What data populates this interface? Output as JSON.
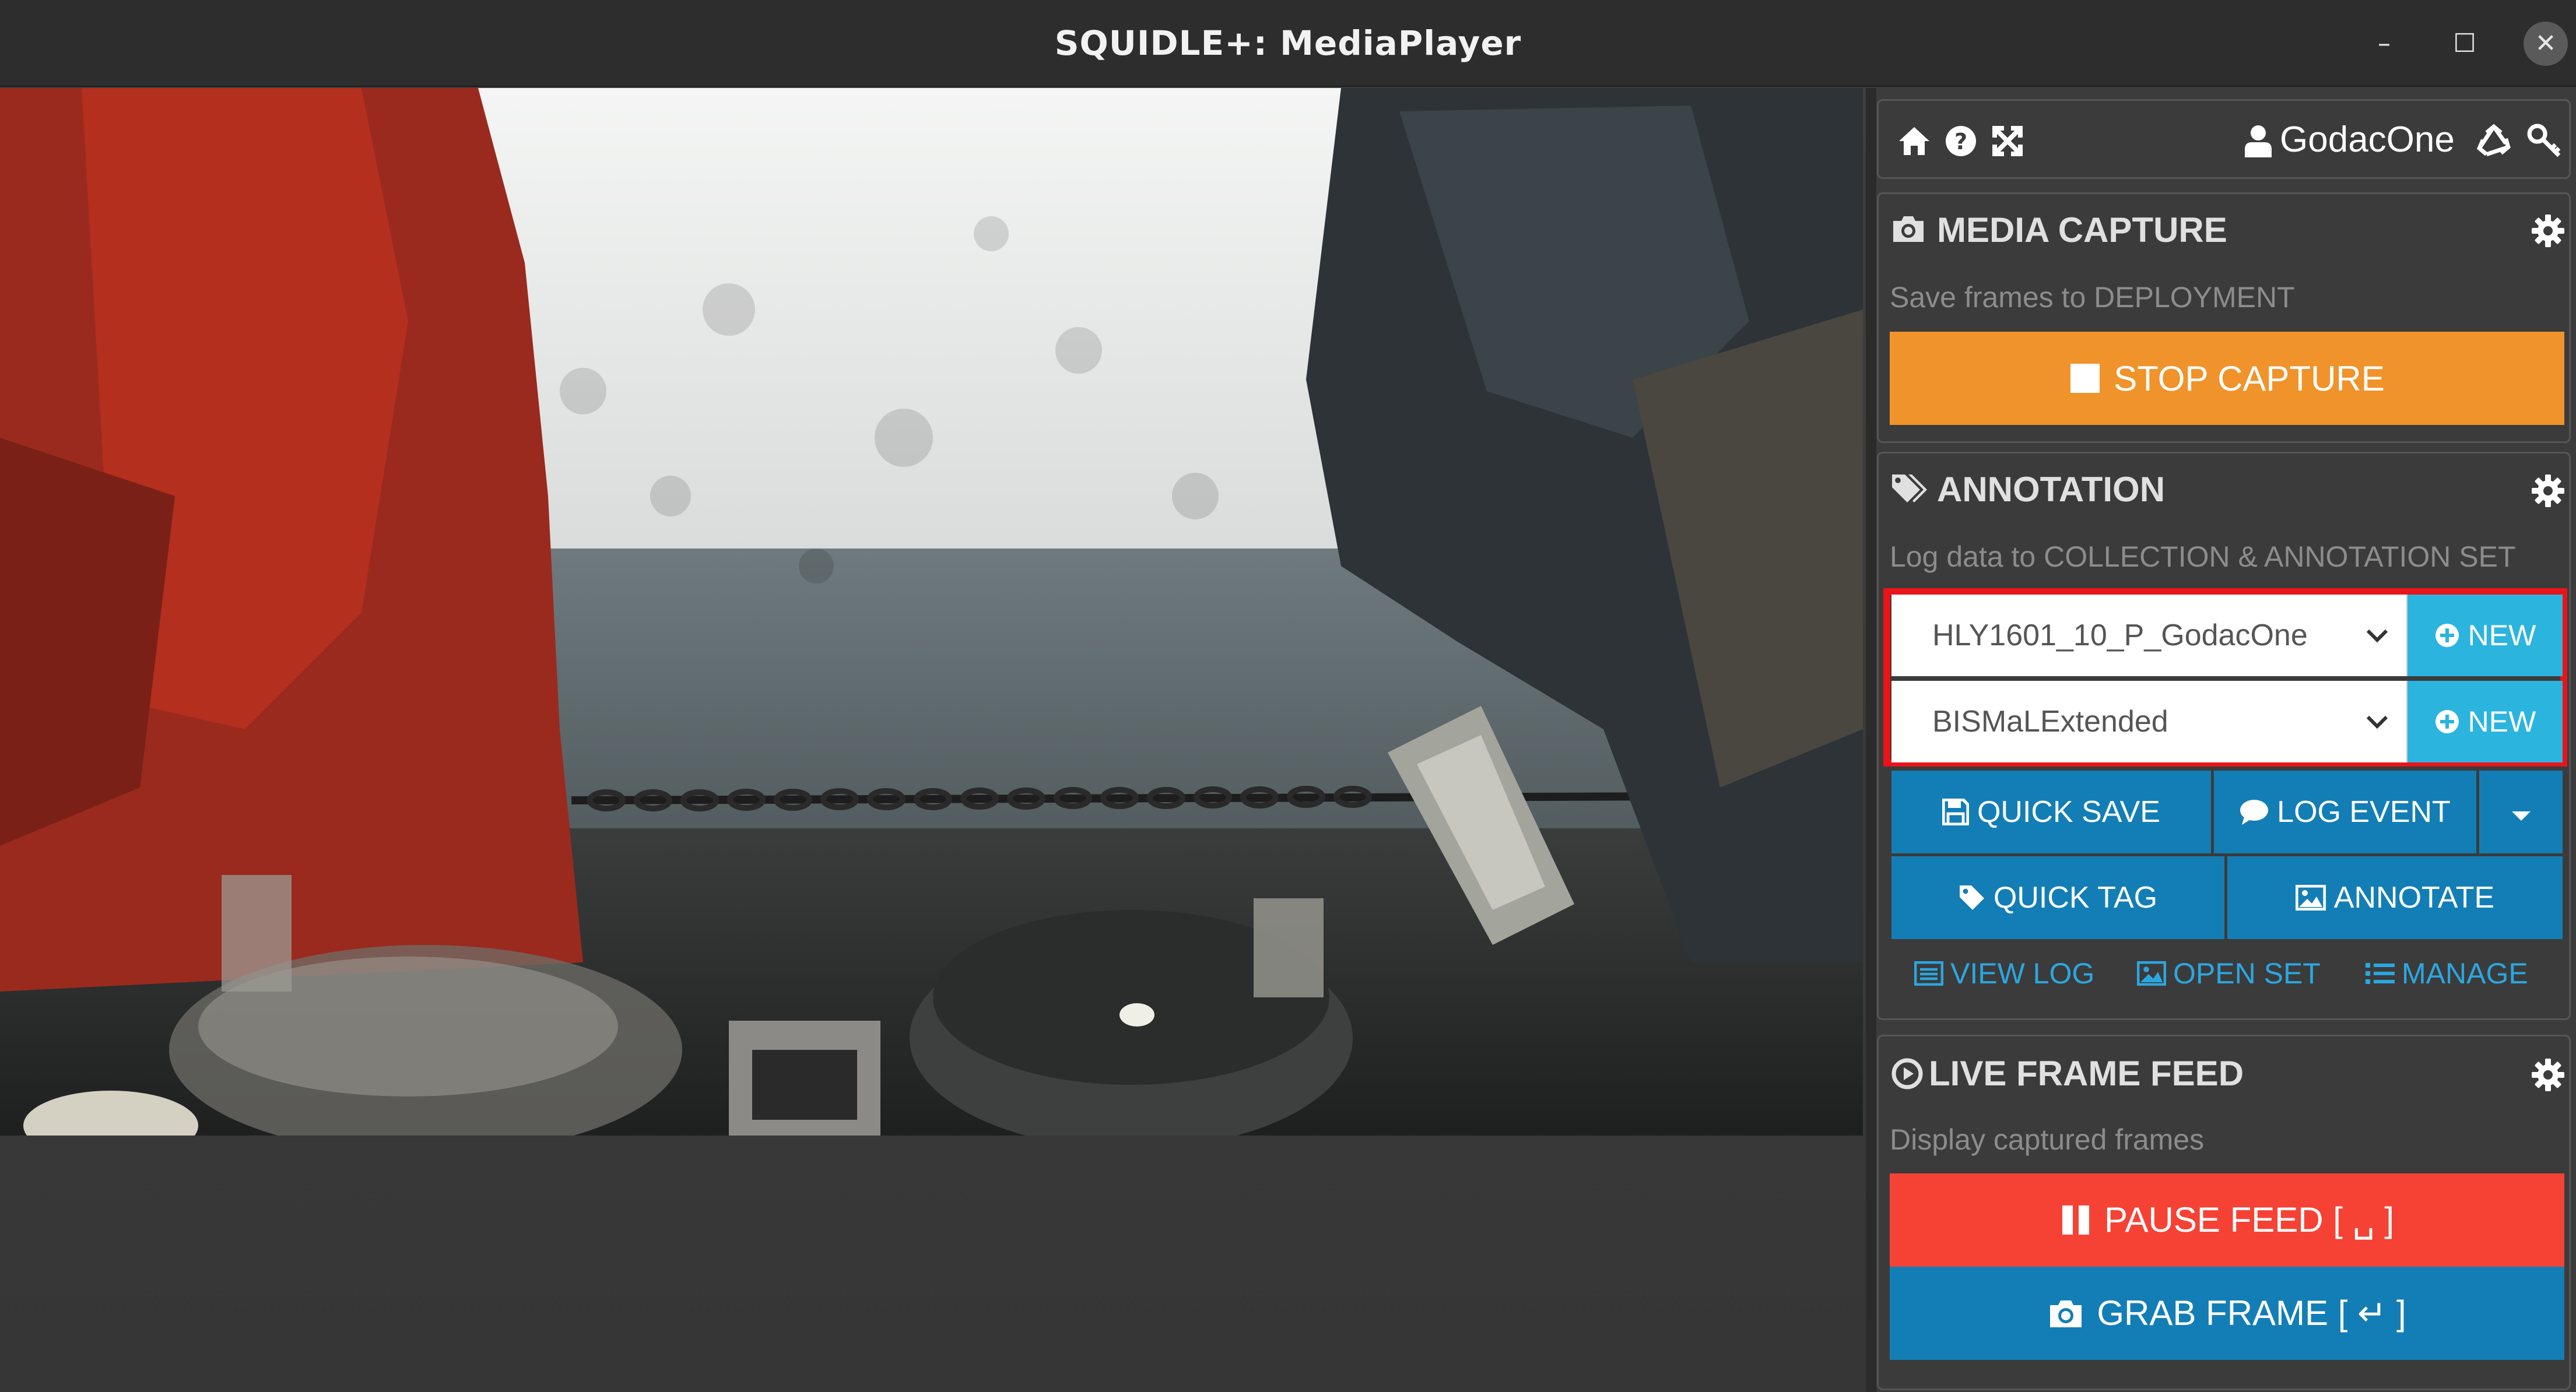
{
  "window": {
    "title": "SQUIDLE+: MediaPlayer",
    "minimize": "–",
    "maximize": "☐",
    "close": "✕"
  },
  "userbar": {
    "username": "GodacOne"
  },
  "media_capture": {
    "title": "MEDIA CAPTURE",
    "subtitle": "Save frames to DEPLOYMENT",
    "stop_button": "STOP CAPTURE",
    "color": "#f0932a"
  },
  "annotation": {
    "title": "ANNOTATION",
    "subtitle": "Log data to COLLECTION & ANNOTATION SET",
    "collection_selected": "HLY1601_10_P_GodacOne",
    "annotation_set_selected": "BISMaLExtended",
    "new_label_1": "NEW",
    "new_label_2": "NEW",
    "quick_save": "QUICK SAVE",
    "log_event": "LOG EVENT",
    "quick_tag": "QUICK TAG",
    "annotate": "ANNOTATE",
    "view_log": "VIEW LOG",
    "open_set": "OPEN SET",
    "manage": "MANAGE",
    "highlight_color": "#e8141a",
    "button_color": "#137eb5",
    "new_color": "#2bb4de"
  },
  "live_feed": {
    "title": "LIVE FRAME FEED",
    "subtitle": "Display captured frames",
    "pause_button": "PAUSE FEED [ ␣ ]",
    "grab_button": "GRAB FRAME [ ↵ ]",
    "pause_color": "#f64234",
    "grab_color": "#137eb5"
  },
  "icons": {
    "home": "home-icon",
    "help": "help-icon",
    "fullscreen": "fullscreen-icon",
    "user": "user-icon",
    "recycle": "recycle-icon",
    "key": "key-icon",
    "camera": "camera-icon",
    "tags": "tags-icon",
    "play": "play-circle-icon",
    "gear": "gear-icon"
  }
}
